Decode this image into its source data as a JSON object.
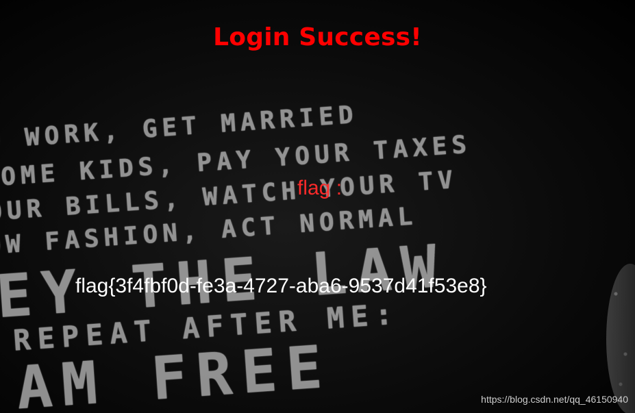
{
  "page": {
    "title": "Login Success!",
    "flag_label": "flag :",
    "flag_value": "flag{3f4fbf0d-fe3a-4727-aba6-9537d41f53e8}",
    "watermark": "https://blog.csdn.net/qq_46150940"
  },
  "background": {
    "lines": [
      "O WORK, GET MARRIED",
      "SOME KIDS, PAY YOUR TAXES",
      "OUR BILLS, WATCH YOUR TV",
      "OW FASHION, ACT NORMAL",
      "EY THE LAW",
      "REPEAT AFTER ME:",
      "AM FREE"
    ]
  },
  "colors": {
    "title": "#ff0000",
    "flag_label": "#ff2a2a",
    "flag_value": "#ffffff",
    "background": "#000000"
  }
}
